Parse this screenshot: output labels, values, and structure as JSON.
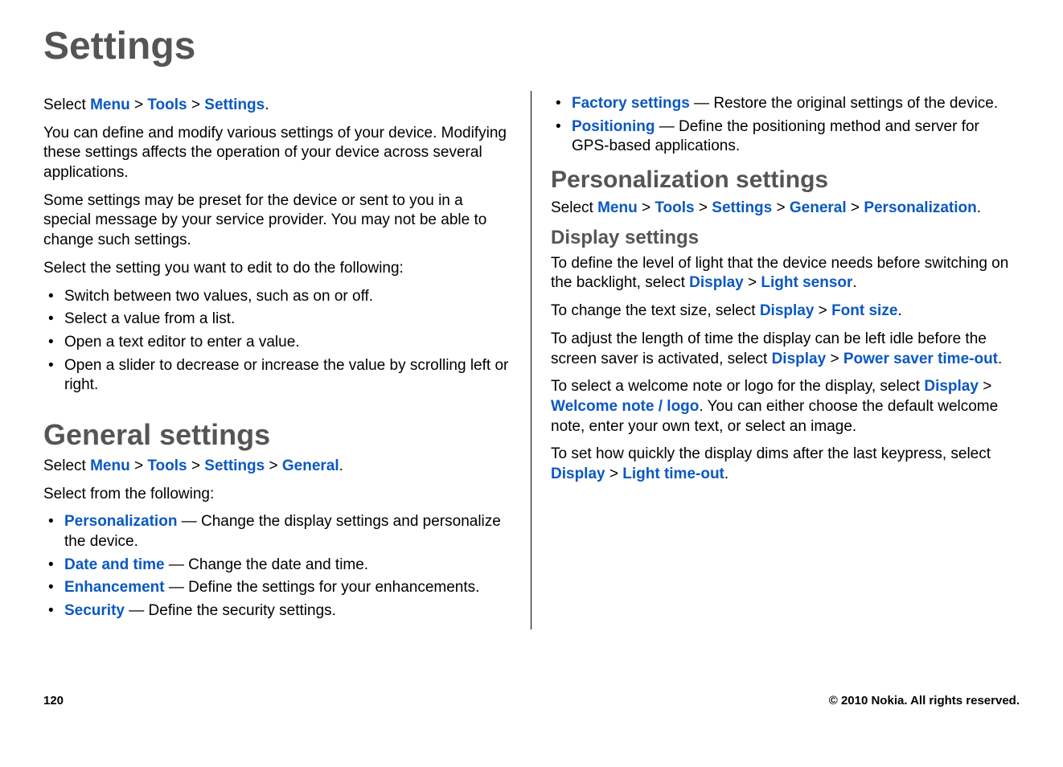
{
  "title": "Settings",
  "intro": {
    "selectPrefix": "Select ",
    "path": [
      "Menu",
      "Tools",
      "Settings"
    ],
    "p1": "You can define and modify various settings of your device. Modifying these settings affects the operation of your device across several applications.",
    "p2": "Some settings may be preset for the device or sent to you in a special message by your service provider. You may not be able to change such settings.",
    "p3": "Select the setting you want to edit to do the following:",
    "bullets": [
      "Switch between two values, such as on or off.",
      "Select a value from a list.",
      "Open a text editor to enter a value.",
      "Open a slider to decrease or increase the value by scrolling left or right."
    ]
  },
  "general": {
    "heading": "General settings",
    "selectPrefix": "Select ",
    "path": [
      "Menu",
      "Tools",
      "Settings",
      "General"
    ],
    "followingText": "Select from the following:",
    "items": [
      {
        "term": "Personalization",
        "desc": " — Change the display settings and personalize the device."
      },
      {
        "term": "Date and time",
        "desc": " — Change the date and time."
      },
      {
        "term": "Enhancement",
        "desc": " — Define the settings for your enhancements."
      },
      {
        "term": "Security",
        "desc": " — Define the security settings."
      },
      {
        "term": "Factory settings",
        "desc": " — Restore the original settings of the device."
      },
      {
        "term": "Positioning",
        "desc": " — Define the positioning method and server for GPS-based applications."
      }
    ]
  },
  "personalization": {
    "heading": "Personalization settings",
    "selectPrefix": "Select ",
    "path": [
      "Menu",
      "Tools",
      "Settings",
      "General",
      "Personalization"
    ]
  },
  "display": {
    "heading": "Display settings",
    "p1a": "To define the level of light that the device needs before switching on the backlight, select ",
    "p1path": [
      "Display",
      "Light sensor"
    ],
    "p2a": "To change the text size, select ",
    "p2path": [
      "Display",
      "Font size"
    ],
    "p3a": "To adjust the length of time the display can be left idle before the screen saver is activated, select ",
    "p3path": [
      "Display",
      "Power saver time-out"
    ],
    "p4a": "To select a welcome note or logo for the display, select ",
    "p4path": [
      "Display",
      "Welcome note / logo"
    ],
    "p4b": ". You can either choose the default welcome note, enter your own text, or select an image.",
    "p5a": "To set how quickly the display dims after the last keypress, select ",
    "p5path": [
      "Display",
      "Light time-out"
    ]
  },
  "footer": {
    "pageNum": "120",
    "copyright": "© 2010 Nokia. All rights reserved."
  },
  "gt": " > "
}
